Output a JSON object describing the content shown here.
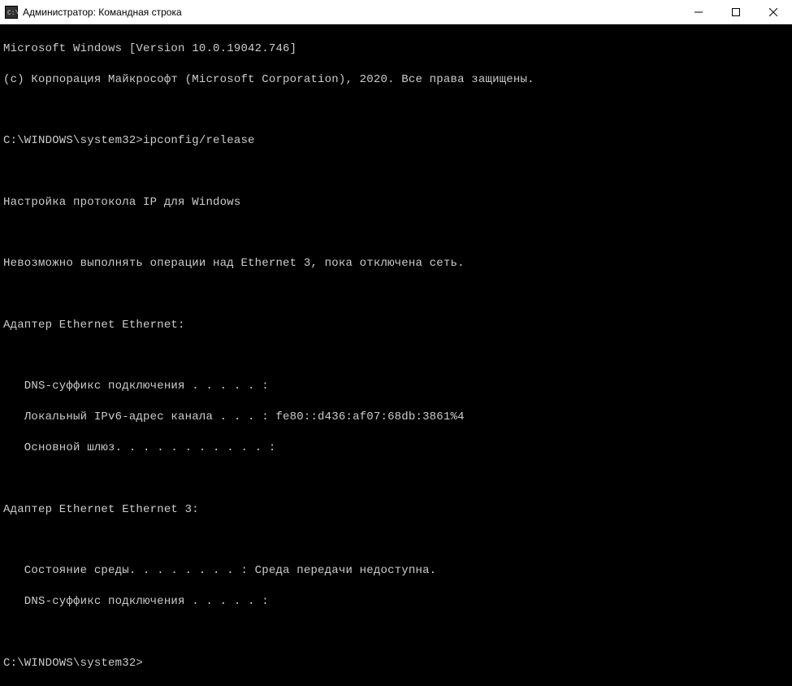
{
  "titlebar": {
    "title": "Администратор: Командная строка"
  },
  "terminal": {
    "version_line": "Microsoft Windows [Version 10.0.19042.746]",
    "copyright_line": "(c) Корпорация Майкрософт (Microsoft Corporation), 2020. Все права защищены.",
    "prompt1": "C:\\WINDOWS\\system32>",
    "command1": "ipconfig/release",
    "heading": "Настройка протокола IP для Windows",
    "error_line": "Невозможно выполнять операции над Ethernet 3, пока отключена сеть.",
    "adapter1_title": "Адаптер Ethernet Ethernet:",
    "adapter1_dns": "   DNS-суффикс подключения . . . . . :",
    "adapter1_ipv6": "   Локальный IPv6-адрес канала . . . : fe80::d436:af07:68db:3861%4",
    "adapter1_gateway": "   Основной шлюз. . . . . . . . . . . :",
    "adapter2_title": "Адаптер Ethernet Ethernet 3:",
    "adapter2_media": "   Состояние среды. . . . . . . . : Среда передачи недоступна.",
    "adapter2_dns": "   DNS-суффикс подключения . . . . . :",
    "prompt2": "C:\\WINDOWS\\system32>"
  }
}
